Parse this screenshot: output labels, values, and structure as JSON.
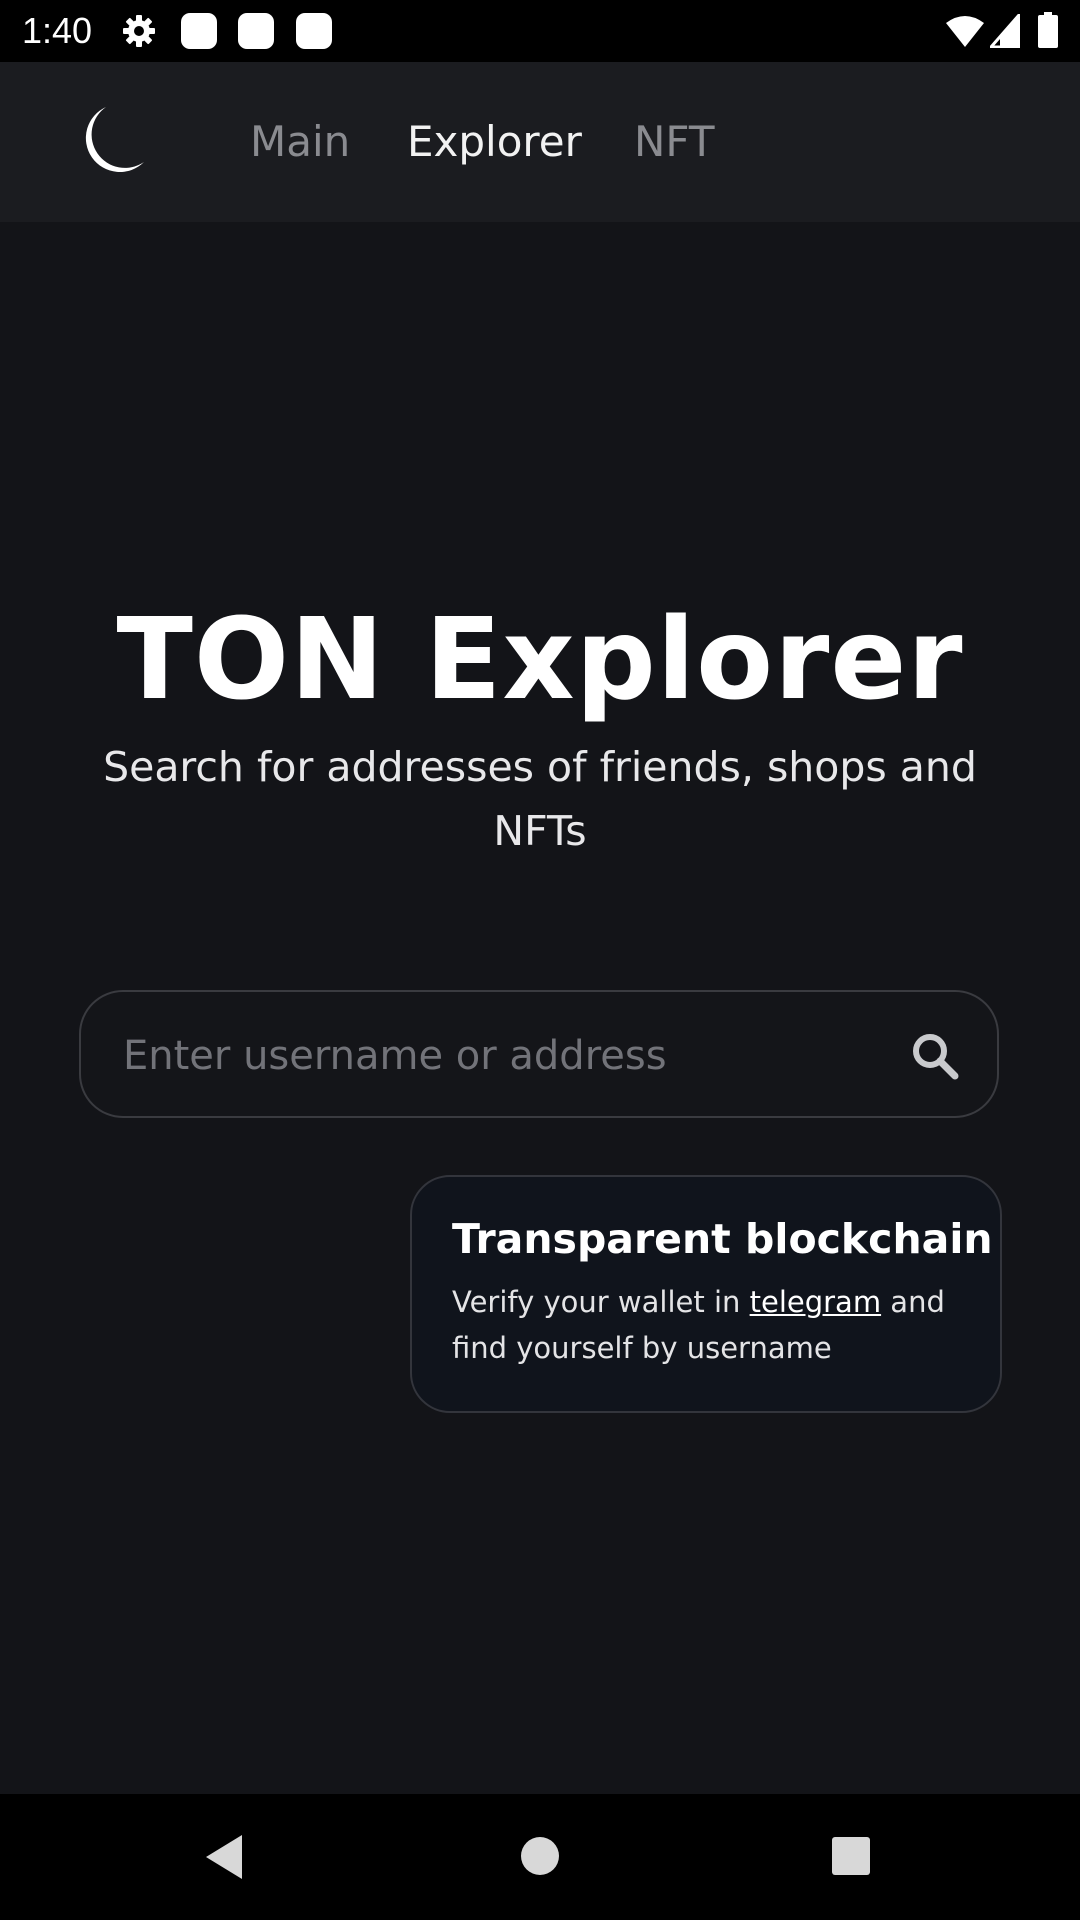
{
  "status_bar": {
    "time": "1:40",
    "icons": [
      "gear-icon",
      "notification-icon",
      "notification-icon",
      "notification-icon",
      "wifi-icon",
      "signal-icon",
      "battery-icon"
    ]
  },
  "header": {
    "logo_icon": "moon-icon",
    "nav": [
      {
        "label": "Main",
        "active": false
      },
      {
        "label": "Explorer",
        "active": true
      },
      {
        "label": "NFT",
        "active": false
      }
    ]
  },
  "hero": {
    "title": "TON Explorer",
    "subtitle": "Search for addresses of friends, shops and NFTs"
  },
  "search": {
    "placeholder": "Enter username or address",
    "value": "",
    "icon": "search-icon"
  },
  "card": {
    "title": "Transparent blockchain",
    "text_before": "Verify your wallet in ",
    "link": "telegram",
    "text_after": " and find yourself by username"
  },
  "system_nav": {
    "icons": [
      "back-icon",
      "home-icon",
      "recents-icon"
    ]
  },
  "colors": {
    "background": "#131418",
    "header_background": "#1b1c20",
    "card_background": "#10141c",
    "nav_inactive": "#8a8b90",
    "nav_active": "#f2f2f2"
  }
}
